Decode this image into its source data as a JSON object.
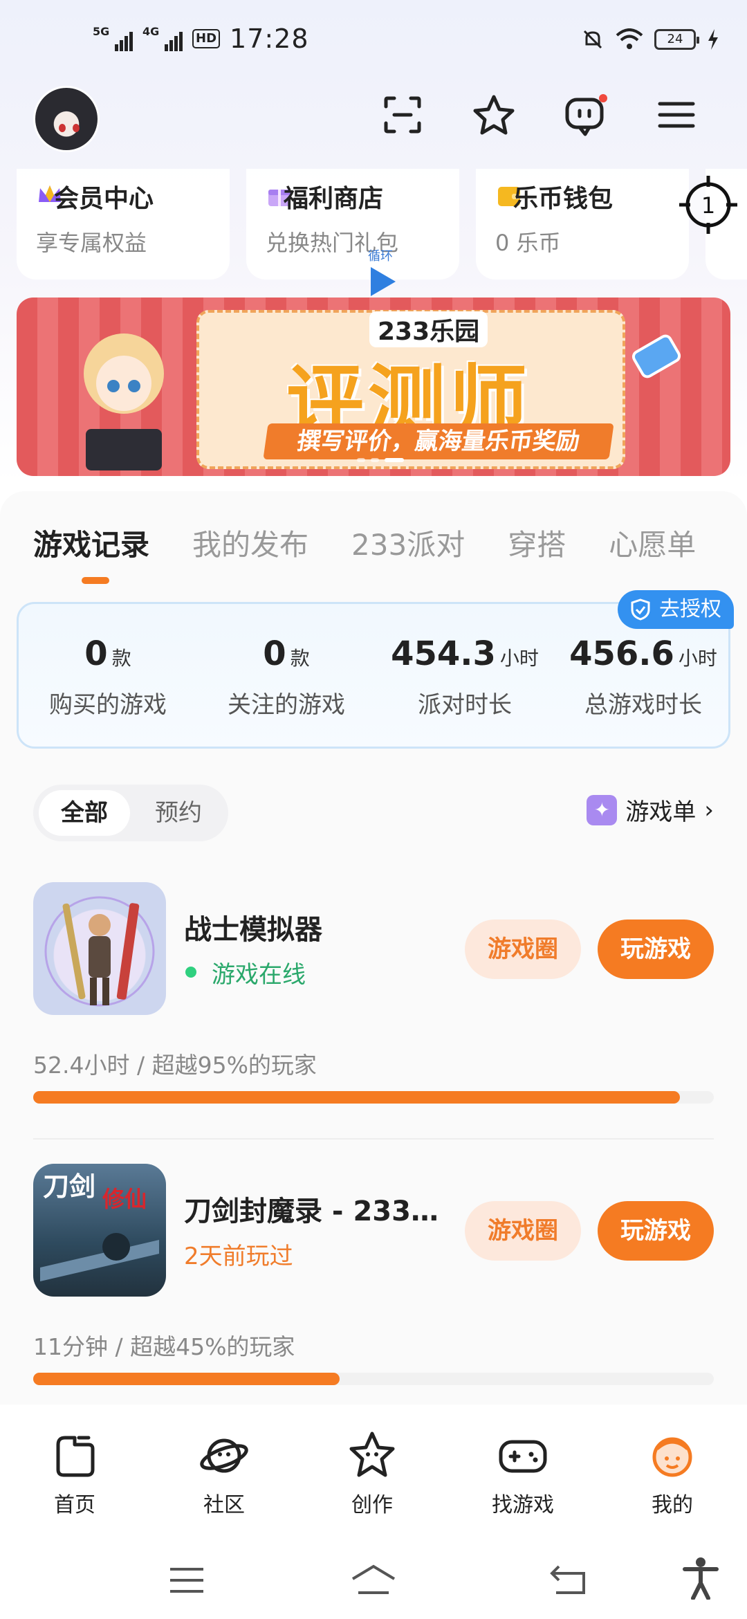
{
  "status_bar": {
    "net1": "5G",
    "net2": "4G",
    "hd": "HD",
    "time": "17:28",
    "battery": "24"
  },
  "quick_cards": [
    {
      "title": "会员中心",
      "subtitle": "享专属权益",
      "icon": "crown-icon",
      "color": "#8a5cf6"
    },
    {
      "title": "福利商店",
      "subtitle": "兑换热门礼包",
      "icon": "gift-icon",
      "color": "#b48cf2"
    },
    {
      "title": "乐币钱包",
      "subtitle": "0 乐币",
      "icon": "wallet-icon",
      "color": "#f5b820"
    }
  ],
  "floater": {
    "number": "1"
  },
  "loop_overlay": {
    "label": "循环"
  },
  "banner": {
    "brand": "233乐园",
    "title": "评测师",
    "subtitle": "撰写评价，赢海量乐币奖励"
  },
  "tabs": [
    {
      "label": "游戏记录",
      "active": true
    },
    {
      "label": "我的发布",
      "active": false
    },
    {
      "label": "233派对",
      "active": false
    },
    {
      "label": "穿搭",
      "active": false
    },
    {
      "label": "心愿单",
      "active": false
    }
  ],
  "stats": {
    "auth_label": "去授权",
    "items": [
      {
        "value": "0",
        "unit": "款",
        "label": "购买的游戏"
      },
      {
        "value": "0",
        "unit": "款",
        "label": "关注的游戏"
      },
      {
        "value": "454.3",
        "unit": "小时",
        "label": "派对时长"
      },
      {
        "value": "456.6",
        "unit": "小时",
        "label": "总游戏时长"
      }
    ]
  },
  "filter": {
    "all": "全部",
    "reserve": "预约"
  },
  "game_list_link": "游戏单",
  "games": [
    {
      "name": "战士模拟器",
      "status": "游戏在线",
      "status_type": "online",
      "circle_label": "游戏圈",
      "play_label": "玩游戏",
      "stat": "52.4小时 / 超越95%的玩家",
      "progress": 0.95
    },
    {
      "name": "刀剑封魔录 - 233…",
      "status": "2天前玩过",
      "status_type": "recent",
      "circle_label": "游戏圈",
      "play_label": "玩游戏",
      "stat": "11分钟 / 超越45%的玩家",
      "progress": 0.45,
      "thumb_text1": "刀剑",
      "thumb_text2": "修仙"
    }
  ],
  "bottom_nav": [
    {
      "label": "首页",
      "icon": "home-icon"
    },
    {
      "label": "社区",
      "icon": "planet-icon"
    },
    {
      "label": "创作",
      "icon": "star-create-icon"
    },
    {
      "label": "找游戏",
      "icon": "gamepad-icon"
    },
    {
      "label": "我的",
      "icon": "profile-face-icon",
      "active": true
    }
  ],
  "colors": {
    "accent": "#f57b22",
    "online": "#2aa86b",
    "auth": "#3391f0"
  }
}
